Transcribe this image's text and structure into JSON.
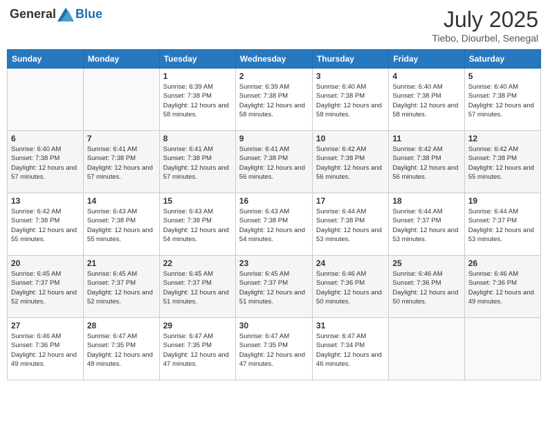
{
  "header": {
    "logo_general": "General",
    "logo_blue": "Blue",
    "month_year": "July 2025",
    "location": "Tiebo, Diourbel, Senegal"
  },
  "weekdays": [
    "Sunday",
    "Monday",
    "Tuesday",
    "Wednesday",
    "Thursday",
    "Friday",
    "Saturday"
  ],
  "weeks": [
    [
      {
        "day": "",
        "info": ""
      },
      {
        "day": "",
        "info": ""
      },
      {
        "day": "1",
        "info": "Sunrise: 6:39 AM\nSunset: 7:38 PM\nDaylight: 12 hours and 58 minutes."
      },
      {
        "day": "2",
        "info": "Sunrise: 6:39 AM\nSunset: 7:38 PM\nDaylight: 12 hours and 58 minutes."
      },
      {
        "day": "3",
        "info": "Sunrise: 6:40 AM\nSunset: 7:38 PM\nDaylight: 12 hours and 58 minutes."
      },
      {
        "day": "4",
        "info": "Sunrise: 6:40 AM\nSunset: 7:38 PM\nDaylight: 12 hours and 58 minutes."
      },
      {
        "day": "5",
        "info": "Sunrise: 6:40 AM\nSunset: 7:38 PM\nDaylight: 12 hours and 57 minutes."
      }
    ],
    [
      {
        "day": "6",
        "info": "Sunrise: 6:40 AM\nSunset: 7:38 PM\nDaylight: 12 hours and 57 minutes."
      },
      {
        "day": "7",
        "info": "Sunrise: 6:41 AM\nSunset: 7:38 PM\nDaylight: 12 hours and 57 minutes."
      },
      {
        "day": "8",
        "info": "Sunrise: 6:41 AM\nSunset: 7:38 PM\nDaylight: 12 hours and 57 minutes."
      },
      {
        "day": "9",
        "info": "Sunrise: 6:41 AM\nSunset: 7:38 PM\nDaylight: 12 hours and 56 minutes."
      },
      {
        "day": "10",
        "info": "Sunrise: 6:42 AM\nSunset: 7:38 PM\nDaylight: 12 hours and 56 minutes."
      },
      {
        "day": "11",
        "info": "Sunrise: 6:42 AM\nSunset: 7:38 PM\nDaylight: 12 hours and 56 minutes."
      },
      {
        "day": "12",
        "info": "Sunrise: 6:42 AM\nSunset: 7:38 PM\nDaylight: 12 hours and 55 minutes."
      }
    ],
    [
      {
        "day": "13",
        "info": "Sunrise: 6:42 AM\nSunset: 7:38 PM\nDaylight: 12 hours and 55 minutes."
      },
      {
        "day": "14",
        "info": "Sunrise: 6:43 AM\nSunset: 7:38 PM\nDaylight: 12 hours and 55 minutes."
      },
      {
        "day": "15",
        "info": "Sunrise: 6:43 AM\nSunset: 7:38 PM\nDaylight: 12 hours and 54 minutes."
      },
      {
        "day": "16",
        "info": "Sunrise: 6:43 AM\nSunset: 7:38 PM\nDaylight: 12 hours and 54 minutes."
      },
      {
        "day": "17",
        "info": "Sunrise: 6:44 AM\nSunset: 7:38 PM\nDaylight: 12 hours and 53 minutes."
      },
      {
        "day": "18",
        "info": "Sunrise: 6:44 AM\nSunset: 7:37 PM\nDaylight: 12 hours and 53 minutes."
      },
      {
        "day": "19",
        "info": "Sunrise: 6:44 AM\nSunset: 7:37 PM\nDaylight: 12 hours and 53 minutes."
      }
    ],
    [
      {
        "day": "20",
        "info": "Sunrise: 6:45 AM\nSunset: 7:37 PM\nDaylight: 12 hours and 52 minutes."
      },
      {
        "day": "21",
        "info": "Sunrise: 6:45 AM\nSunset: 7:37 PM\nDaylight: 12 hours and 52 minutes."
      },
      {
        "day": "22",
        "info": "Sunrise: 6:45 AM\nSunset: 7:37 PM\nDaylight: 12 hours and 51 minutes."
      },
      {
        "day": "23",
        "info": "Sunrise: 6:45 AM\nSunset: 7:37 PM\nDaylight: 12 hours and 51 minutes."
      },
      {
        "day": "24",
        "info": "Sunrise: 6:46 AM\nSunset: 7:36 PM\nDaylight: 12 hours and 50 minutes."
      },
      {
        "day": "25",
        "info": "Sunrise: 6:46 AM\nSunset: 7:36 PM\nDaylight: 12 hours and 50 minutes."
      },
      {
        "day": "26",
        "info": "Sunrise: 6:46 AM\nSunset: 7:36 PM\nDaylight: 12 hours and 49 minutes."
      }
    ],
    [
      {
        "day": "27",
        "info": "Sunrise: 6:46 AM\nSunset: 7:36 PM\nDaylight: 12 hours and 49 minutes."
      },
      {
        "day": "28",
        "info": "Sunrise: 6:47 AM\nSunset: 7:35 PM\nDaylight: 12 hours and 48 minutes."
      },
      {
        "day": "29",
        "info": "Sunrise: 6:47 AM\nSunset: 7:35 PM\nDaylight: 12 hours and 47 minutes."
      },
      {
        "day": "30",
        "info": "Sunrise: 6:47 AM\nSunset: 7:35 PM\nDaylight: 12 hours and 47 minutes."
      },
      {
        "day": "31",
        "info": "Sunrise: 6:47 AM\nSunset: 7:34 PM\nDaylight: 12 hours and 46 minutes."
      },
      {
        "day": "",
        "info": ""
      },
      {
        "day": "",
        "info": ""
      }
    ]
  ]
}
